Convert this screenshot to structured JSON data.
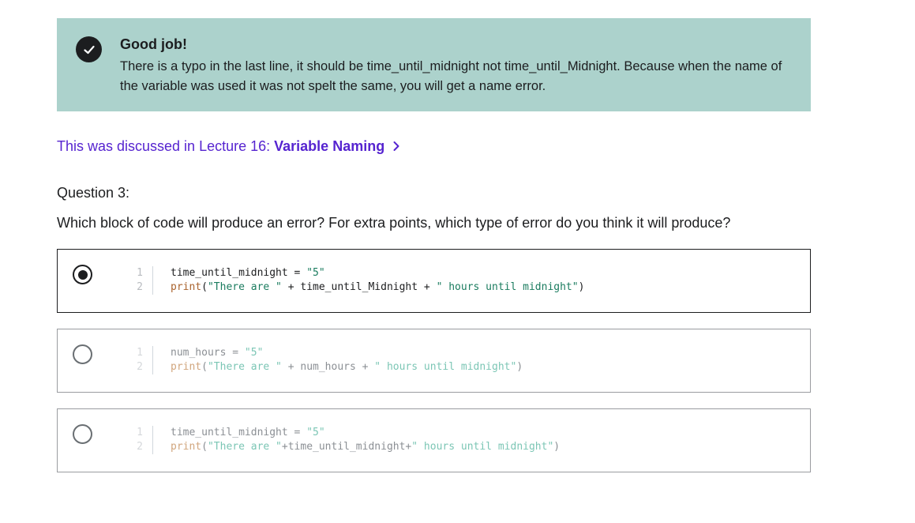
{
  "feedback": {
    "title": "Good job!",
    "message": "There is a typo in the last line, it should be time_until_midnight not time_until_Midnight. Because when the name of the variable was used it was not spelt the same, you will get a name error.",
    "icon": "check-icon",
    "background_color": "#acd2cc"
  },
  "lecture_link": {
    "prefix": "This was discussed in Lecture 16:",
    "title": "Variable Naming",
    "icon": "chevron-right-icon",
    "color": "#5624d0"
  },
  "question": {
    "number": "Question 3:",
    "text": "Which block of code will produce an error? For extra points, which type of error do you think it will produce?"
  },
  "options": [
    {
      "selected": true,
      "lines": [
        {
          "n": "1",
          "a": "time_until_midnight = ",
          "b": "\"5\"",
          "c": "",
          "d": "",
          "e": ""
        },
        {
          "n": "2",
          "a": "print",
          "b": "(",
          "c": "\"There are \"",
          "d": " + time_until_Midnight + ",
          "e": "\" hours until midnight\"",
          "f": ")"
        }
      ]
    },
    {
      "selected": false,
      "lines": [
        {
          "n": "1",
          "a": "num_hours = ",
          "b": "\"5\""
        },
        {
          "n": "2",
          "a": "print",
          "b": "(",
          "c": "\"There are \"",
          "d": " + num_hours + ",
          "e": "\" hours until midnight\"",
          "f": ")"
        }
      ]
    },
    {
      "selected": false,
      "lines": [
        {
          "n": "1",
          "a": "time_until_midnight = ",
          "b": "\"5\""
        },
        {
          "n": "2",
          "a": "print",
          "b": "(",
          "c": "\"There are \"",
          "d": "+time_until_midnight+",
          "e": "\" hours until midnight\"",
          "f": ")"
        }
      ]
    }
  ]
}
